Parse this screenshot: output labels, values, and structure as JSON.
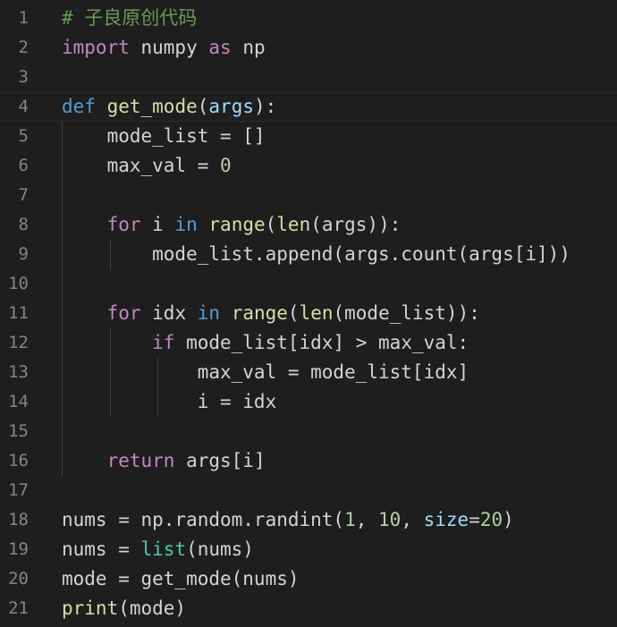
{
  "editor": {
    "language": "python",
    "theme_colors": {
      "background": "#1e1e1e",
      "line_number": "#858585",
      "comment": "#6a9955",
      "keyword": "#c586c0",
      "def_keyword": "#569cd6",
      "function": "#dcdcaa",
      "parameter": "#9cdcfe",
      "number": "#b5cea8",
      "builtin": "#4ec9b0",
      "text": "#d4d4d4"
    },
    "lines": [
      {
        "num": "1",
        "tokens": [
          {
            "t": "# 子良原创代码",
            "c": "comment"
          }
        ]
      },
      {
        "num": "2",
        "tokens": [
          {
            "t": "import",
            "c": "kw"
          },
          {
            "t": " numpy ",
            "c": "var"
          },
          {
            "t": "as",
            "c": "kw"
          },
          {
            "t": " np",
            "c": "var"
          }
        ]
      },
      {
        "num": "3",
        "tokens": []
      },
      {
        "num": "4",
        "tokens": [
          {
            "t": "def",
            "c": "def"
          },
          {
            "t": " ",
            "c": "var"
          },
          {
            "t": "get_mode",
            "c": "fn"
          },
          {
            "t": "(",
            "c": "var"
          },
          {
            "t": "args",
            "c": "param"
          },
          {
            "t": "):",
            "c": "var"
          }
        ]
      },
      {
        "num": "5",
        "tokens": [
          {
            "t": "    mode_list = []",
            "c": "var"
          }
        ]
      },
      {
        "num": "6",
        "tokens": [
          {
            "t": "    max_val = ",
            "c": "var"
          },
          {
            "t": "0",
            "c": "num"
          }
        ]
      },
      {
        "num": "7",
        "tokens": []
      },
      {
        "num": "8",
        "tokens": [
          {
            "t": "    ",
            "c": "var"
          },
          {
            "t": "for",
            "c": "kw"
          },
          {
            "t": " i ",
            "c": "var"
          },
          {
            "t": "in",
            "c": "def"
          },
          {
            "t": " ",
            "c": "var"
          },
          {
            "t": "range",
            "c": "fn"
          },
          {
            "t": "(",
            "c": "var"
          },
          {
            "t": "len",
            "c": "fn"
          },
          {
            "t": "(args)):",
            "c": "var"
          }
        ]
      },
      {
        "num": "9",
        "tokens": [
          {
            "t": "        mode_list.append(args.count(args[i]))",
            "c": "var"
          }
        ]
      },
      {
        "num": "10",
        "tokens": []
      },
      {
        "num": "11",
        "tokens": [
          {
            "t": "    ",
            "c": "var"
          },
          {
            "t": "for",
            "c": "kw"
          },
          {
            "t": " idx ",
            "c": "var"
          },
          {
            "t": "in",
            "c": "def"
          },
          {
            "t": " ",
            "c": "var"
          },
          {
            "t": "range",
            "c": "fn"
          },
          {
            "t": "(",
            "c": "var"
          },
          {
            "t": "len",
            "c": "fn"
          },
          {
            "t": "(mode_list)):",
            "c": "var"
          }
        ]
      },
      {
        "num": "12",
        "tokens": [
          {
            "t": "        ",
            "c": "var"
          },
          {
            "t": "if",
            "c": "kw"
          },
          {
            "t": " mode_list[idx] > max_val:",
            "c": "var"
          }
        ]
      },
      {
        "num": "13",
        "tokens": [
          {
            "t": "            max_val = mode_list[idx]",
            "c": "var"
          }
        ]
      },
      {
        "num": "14",
        "tokens": [
          {
            "t": "            i = idx",
            "c": "var"
          }
        ]
      },
      {
        "num": "15",
        "tokens": []
      },
      {
        "num": "16",
        "tokens": [
          {
            "t": "    ",
            "c": "var"
          },
          {
            "t": "return",
            "c": "kw"
          },
          {
            "t": " args[i]",
            "c": "var"
          }
        ]
      },
      {
        "num": "17",
        "tokens": []
      },
      {
        "num": "18",
        "tokens": [
          {
            "t": "nums = np.random.randint(",
            "c": "var"
          },
          {
            "t": "1",
            "c": "num"
          },
          {
            "t": ", ",
            "c": "var"
          },
          {
            "t": "10",
            "c": "num"
          },
          {
            "t": ", ",
            "c": "var"
          },
          {
            "t": "size",
            "c": "param"
          },
          {
            "t": "=",
            "c": "var"
          },
          {
            "t": "20",
            "c": "num"
          },
          {
            "t": ")",
            "c": "var"
          }
        ]
      },
      {
        "num": "19",
        "tokens": [
          {
            "t": "nums = ",
            "c": "var"
          },
          {
            "t": "list",
            "c": "builtin"
          },
          {
            "t": "(nums)",
            "c": "var"
          }
        ]
      },
      {
        "num": "20",
        "tokens": [
          {
            "t": "mode = get_mode(nums)",
            "c": "var"
          }
        ]
      },
      {
        "num": "21",
        "tokens": [
          {
            "t": "print",
            "c": "fn"
          },
          {
            "t": "(mode)",
            "c": "var"
          }
        ]
      }
    ]
  }
}
